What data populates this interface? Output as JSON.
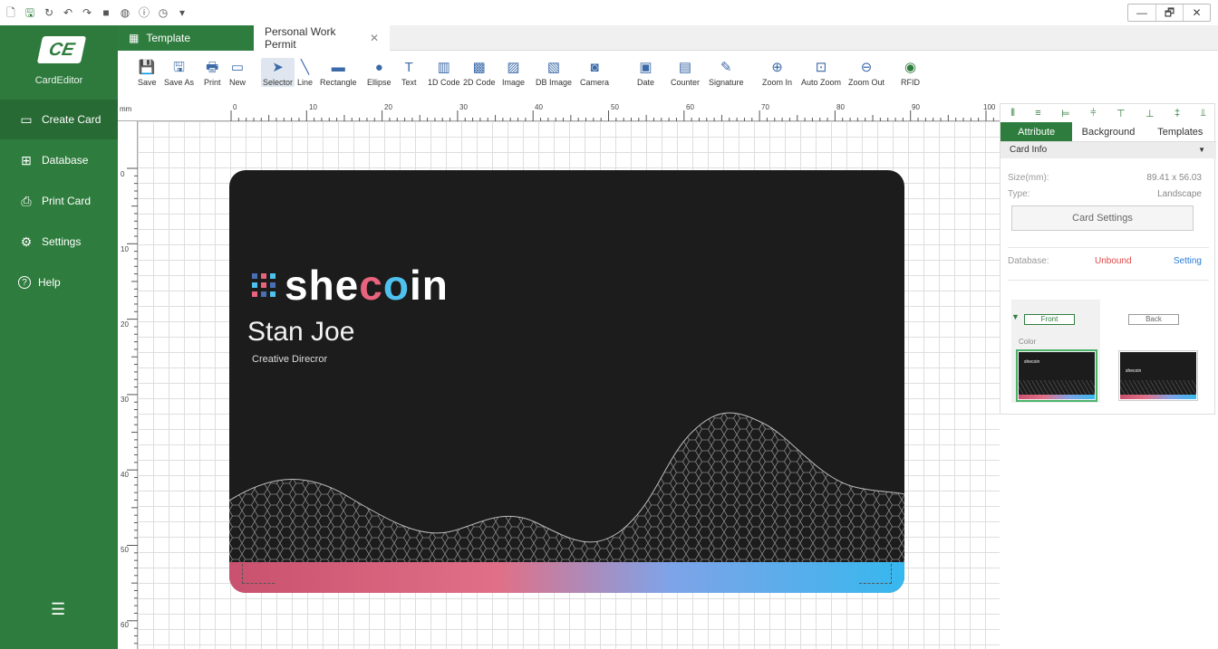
{
  "quick_access": {
    "icons": [
      "new-file-icon",
      "save-icon",
      "refresh-icon",
      "undo-icon",
      "redo-icon",
      "stop-icon",
      "globe-icon",
      "info-icon",
      "clock-icon",
      "dropdown-icon"
    ]
  },
  "window_controls": {
    "minimize": "—",
    "restore": "🗗",
    "close": "✕"
  },
  "app": {
    "logo_mark": "CE",
    "name": "CardEditor"
  },
  "sidebar": {
    "items": [
      {
        "label": "Create Card",
        "icon": "card-icon",
        "glyph": "▭"
      },
      {
        "label": "Database",
        "icon": "table-icon",
        "glyph": "⊞"
      },
      {
        "label": "Print Card",
        "icon": "printer-icon",
        "glyph": "⎙"
      },
      {
        "label": "Settings",
        "icon": "gear-icon",
        "glyph": "⚙"
      },
      {
        "label": "Help",
        "icon": "help-icon",
        "glyph": "?"
      }
    ],
    "collapse_glyph": "☰"
  },
  "tabs": [
    {
      "label": "Template",
      "icon": "template-icon",
      "glyph": "▦"
    },
    {
      "label": "Personal Work Permit",
      "close_glyph": "✕"
    }
  ],
  "toolbar": {
    "tools": [
      {
        "label": "Save",
        "icon": "save-icon",
        "glyph": "💾"
      },
      {
        "label": "Save As",
        "icon": "save-as-icon",
        "glyph": "🖫"
      },
      {
        "label": "Print",
        "icon": "printer-icon",
        "glyph": "🖶"
      },
      {
        "label": "New",
        "icon": "new-card-icon",
        "glyph": "▭"
      },
      {
        "label": "Selector",
        "icon": "pointer-icon",
        "glyph": "➤"
      },
      {
        "label": "Line",
        "icon": "line-icon",
        "glyph": "╲"
      },
      {
        "label": "Rectangle",
        "icon": "rectangle-icon",
        "glyph": "▬"
      },
      {
        "label": "Ellipse",
        "icon": "ellipse-icon",
        "glyph": "●"
      },
      {
        "label": "Text",
        "icon": "text-icon",
        "glyph": "T"
      },
      {
        "label": "1D Code",
        "icon": "barcode-icon",
        "glyph": "▥"
      },
      {
        "label": "2D Code",
        "icon": "qrcode-icon",
        "glyph": "▩"
      },
      {
        "label": "Image",
        "icon": "image-icon",
        "glyph": "▨"
      },
      {
        "label": "DB Image",
        "icon": "db-image-icon",
        "glyph": "▧"
      },
      {
        "label": "Camera",
        "icon": "camera-icon",
        "glyph": "◙"
      },
      {
        "label": "Date",
        "icon": "calendar-icon",
        "glyph": "▣"
      },
      {
        "label": "Counter",
        "icon": "counter-icon",
        "glyph": "▤"
      },
      {
        "label": "Signature",
        "icon": "pen-icon",
        "glyph": "✎"
      },
      {
        "label": "Zoom In",
        "icon": "zoom-in-icon",
        "glyph": "⊕"
      },
      {
        "label": "Auto Zoom",
        "icon": "auto-zoom-icon",
        "glyph": "⊡"
      },
      {
        "label": "Zoom Out",
        "icon": "zoom-out-icon",
        "glyph": "⊖"
      },
      {
        "label": "RFID",
        "icon": "rfid-icon",
        "glyph": "◉"
      }
    ],
    "selected": "Selector"
  },
  "ruler": {
    "unit": "mm",
    "top_labels": [
      "0",
      "10",
      "20",
      "30",
      "40",
      "50",
      "60",
      "70",
      "80",
      "90",
      "100"
    ],
    "left_labels": [
      "0",
      "10",
      "20",
      "30",
      "40",
      "50",
      "60"
    ]
  },
  "card": {
    "brand_prefix": "she",
    "brand_mid": "c",
    "brand_o": "o",
    "brand_suffix": "in",
    "name": "Stan Joe",
    "title": "Creative Direcror",
    "background": "#1c1c1c",
    "band_colors": [
      "#c9516f",
      "#e07087",
      "#7fa3e8",
      "#36b8ee"
    ]
  },
  "panel": {
    "align_icons": [
      "align-left-icon",
      "align-center-icon",
      "align-right-icon",
      "distribute-h-icon",
      "align-top-icon",
      "align-middle-icon",
      "align-bottom-icon",
      "distribute-v-icon"
    ],
    "align_glyphs": [
      "⫴",
      "≡",
      "⊨",
      "⫩",
      "⊤",
      "⊥",
      "‡",
      "⫫"
    ],
    "tabs": [
      "Attribute",
      "Background",
      "Templates"
    ],
    "section": "Card Info",
    "section_arrow": "▼",
    "size_label": "Size(mm):",
    "size_value": "89.41 x 56.03",
    "type_label": "Type:",
    "type_value": "Landscape",
    "card_settings_button": "Card Settings",
    "database_label": "Database:",
    "database_value": "Unbound",
    "database_link": "Setting",
    "front_label": "Front",
    "back_label": "Back",
    "front_arrow": "▼",
    "color_label": "Color",
    "thumb_text": "shecoin"
  }
}
